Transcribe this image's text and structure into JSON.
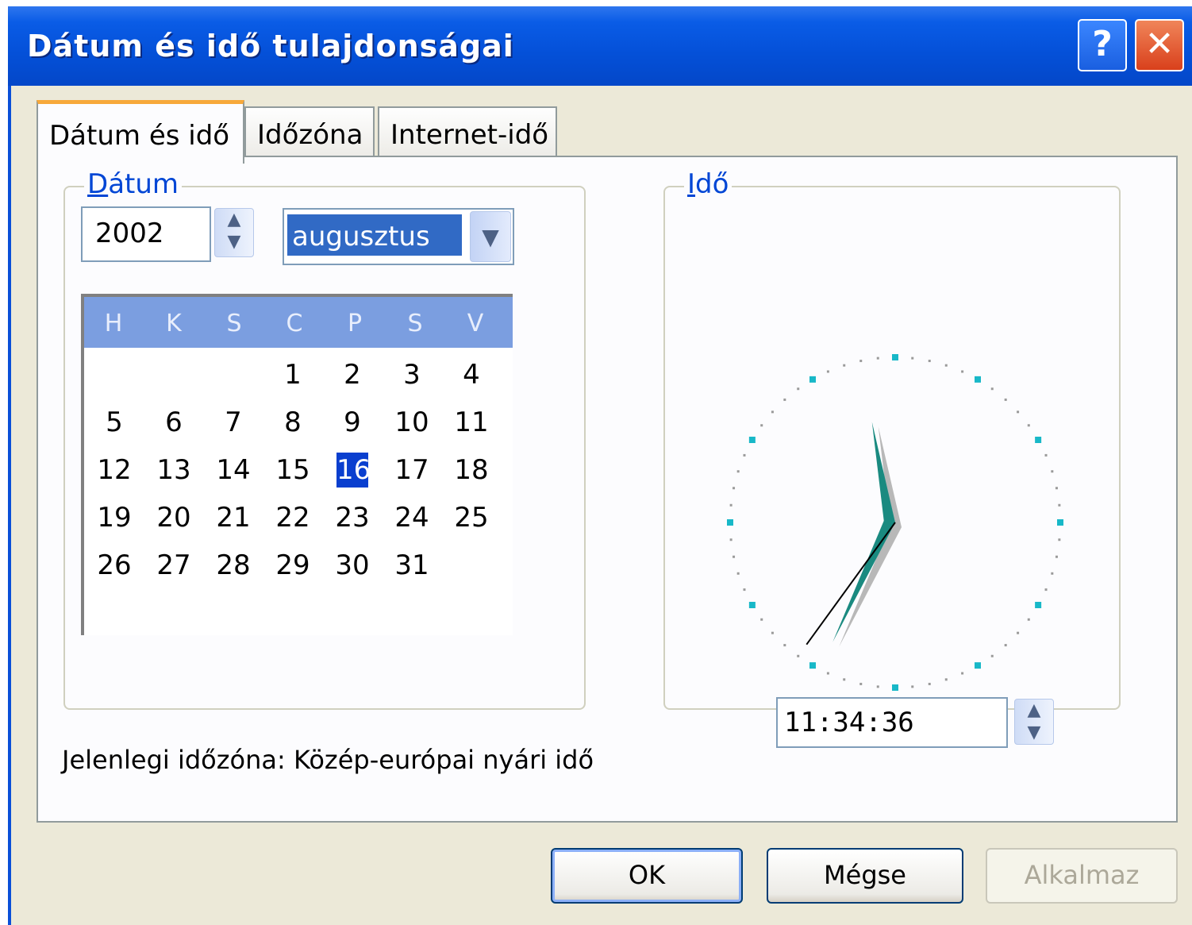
{
  "window": {
    "title": "Dátum és idő tulajdonságai",
    "help_glyph": "?",
    "close_glyph": "✕"
  },
  "tabs": [
    {
      "label": "Dátum és idő",
      "active": true
    },
    {
      "label": "Időzóna",
      "active": false
    },
    {
      "label": "Internet-idő",
      "active": false
    }
  ],
  "date_group": {
    "label_first": "D",
    "label_rest": "átum",
    "year": "2002",
    "month": "augusztus",
    "weekdays": [
      "H",
      "K",
      "S",
      "C",
      "P",
      "S",
      "V"
    ],
    "selected_day": "16",
    "days": [
      [
        "",
        "",
        "",
        "1",
        "2",
        "3",
        "4"
      ],
      [
        "5",
        "6",
        "7",
        "8",
        "9",
        "10",
        "11"
      ],
      [
        "12",
        "13",
        "14",
        "15",
        "16",
        "17",
        "18"
      ],
      [
        "19",
        "20",
        "21",
        "22",
        "23",
        "24",
        "25"
      ],
      [
        "26",
        "27",
        "28",
        "29",
        "30",
        "31",
        ""
      ]
    ]
  },
  "time_group": {
    "label_first": "I",
    "label_rest": "dő",
    "time": "11:34:36",
    "clock": {
      "hour": 11,
      "minute": 34,
      "second": 36
    }
  },
  "timezone_text": "Jelenlegi időzóna: Közép-európai nyári idő",
  "buttons": {
    "ok": "OK",
    "cancel": "Mégse",
    "apply": "Alkalmaz"
  },
  "colors": {
    "title_bar": "#0450d8",
    "accent_teal": "#1a8a80",
    "selection": "#0a3fcf"
  }
}
